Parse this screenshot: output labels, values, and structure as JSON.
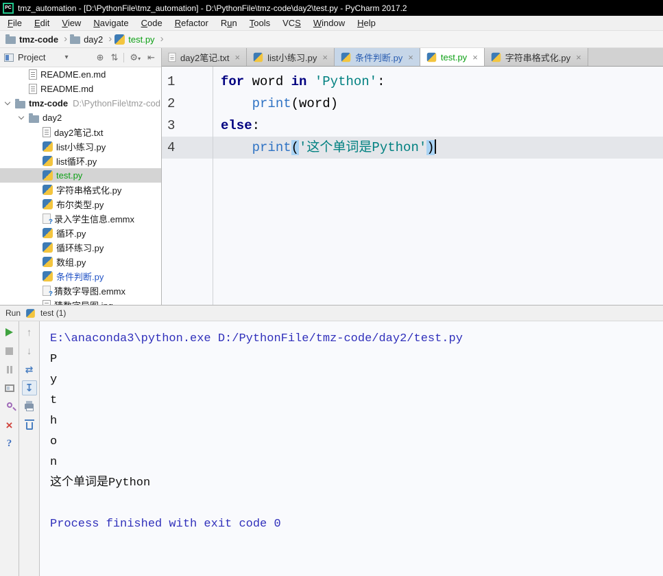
{
  "window": {
    "logo": "PC",
    "title": "tmz_automation - [D:\\PythonFile\\tmz_automation] - D:\\PythonFile\\tmz-code\\day2\\test.py - PyCharm 2017.2"
  },
  "menu": {
    "items": [
      {
        "label": "File",
        "mnemonic": 0
      },
      {
        "label": "Edit",
        "mnemonic": 0
      },
      {
        "label": "View",
        "mnemonic": 0
      },
      {
        "label": "Navigate",
        "mnemonic": 0
      },
      {
        "label": "Code",
        "mnemonic": 0
      },
      {
        "label": "Refactor",
        "mnemonic": 0
      },
      {
        "label": "Run",
        "mnemonic": 1
      },
      {
        "label": "Tools",
        "mnemonic": 0
      },
      {
        "label": "VCS",
        "mnemonic": 2
      },
      {
        "label": "Window",
        "mnemonic": 0
      },
      {
        "label": "Help",
        "mnemonic": 0
      }
    ]
  },
  "breadcrumbs": [
    {
      "label": "tmz-code",
      "icon": "folder",
      "bold": true
    },
    {
      "label": "day2",
      "icon": "folder"
    },
    {
      "label": "test.py",
      "icon": "py",
      "color": "green"
    }
  ],
  "project": {
    "title": "Project",
    "tree": [
      {
        "label": "README.en.md",
        "icon": "txt",
        "indent": 1
      },
      {
        "label": "README.md",
        "icon": "txt",
        "indent": 1
      },
      {
        "label": "tmz-code",
        "icon": "folder",
        "indent": 0,
        "chevron": true,
        "bold": true,
        "path": "D:\\PythonFile\\tmz-cod"
      },
      {
        "label": "day2",
        "icon": "folder",
        "indent": 1,
        "chevron": true
      },
      {
        "label": "day2笔记.txt",
        "icon": "txt",
        "indent": 2
      },
      {
        "label": "list小练习.py",
        "icon": "py",
        "indent": 2
      },
      {
        "label": "list循环.py",
        "icon": "py",
        "indent": 2
      },
      {
        "label": "test.py",
        "icon": "py",
        "indent": 2,
        "selected": true,
        "color": "green"
      },
      {
        "label": "字符串格式化.py",
        "icon": "py",
        "indent": 2
      },
      {
        "label": "布尔类型.py",
        "icon": "py",
        "indent": 2
      },
      {
        "label": "录入学生信息.emmx",
        "icon": "unknown",
        "indent": 2
      },
      {
        "label": "循环.py",
        "icon": "py",
        "indent": 2
      },
      {
        "label": "循环练习.py",
        "icon": "py",
        "indent": 2
      },
      {
        "label": "数组.py",
        "icon": "py",
        "indent": 2
      },
      {
        "label": "条件判断.py",
        "icon": "py",
        "indent": 2,
        "color": "blue"
      },
      {
        "label": "猜数字导图.emmx",
        "icon": "unknown",
        "indent": 2
      },
      {
        "label": "猜数字导图.jpg",
        "icon": "txt",
        "indent": 2
      }
    ]
  },
  "tabs": [
    {
      "label": "day2笔记.txt",
      "icon": "txt",
      "close": "×"
    },
    {
      "label": "list小练习.py",
      "icon": "py",
      "close": "×"
    },
    {
      "label": "条件判断.py",
      "icon": "py",
      "close": "×",
      "state": "modified"
    },
    {
      "label": "test.py",
      "icon": "py",
      "close": "×",
      "state": "active-new"
    },
    {
      "label": "字符串格式化.py",
      "icon": "py",
      "close": "×"
    }
  ],
  "editor": {
    "lines": [
      {
        "num": "1",
        "segments": [
          {
            "t": "for",
            "c": "kw"
          },
          {
            "t": " word ",
            "c": "plain"
          },
          {
            "t": "in",
            "c": "kw"
          },
          {
            "t": " ",
            "c": "plain"
          },
          {
            "t": "'Python'",
            "c": "str"
          },
          {
            "t": ":",
            "c": "plain"
          }
        ]
      },
      {
        "num": "2",
        "segments": [
          {
            "t": "    ",
            "c": "plain"
          },
          {
            "t": "print",
            "c": "builtin"
          },
          {
            "t": "(word)",
            "c": "plain"
          }
        ]
      },
      {
        "num": "3",
        "segments": [
          {
            "t": "else",
            "c": "kw"
          },
          {
            "t": ":",
            "c": "plain"
          }
        ]
      },
      {
        "num": "4",
        "current": true,
        "cursor": true,
        "segments": [
          {
            "t": "    ",
            "c": "plain"
          },
          {
            "t": "print",
            "c": "builtin"
          },
          {
            "t": "(",
            "c": "paren"
          },
          {
            "t": "'这个单词是Python'",
            "c": "str"
          },
          {
            "t": ")",
            "c": "paren"
          }
        ]
      }
    ]
  },
  "run": {
    "label": "Run",
    "tab_label": "test (1)",
    "toolbar_main": [
      "rerun",
      "stop",
      "pause",
      "restore-layout",
      "pin",
      "close",
      "help"
    ],
    "toolbar_console": [
      "up",
      "down",
      "soft-wrap",
      "scroll-end",
      "print",
      "clear"
    ],
    "selected_tool": "scroll-end",
    "output": [
      {
        "text": "E:\\anaconda3\\python.exe D:/PythonFile/tmz-code/day2/test.py",
        "color": "system"
      },
      {
        "text": "P"
      },
      {
        "text": "y"
      },
      {
        "text": "t"
      },
      {
        "text": "h"
      },
      {
        "text": "o"
      },
      {
        "text": "n"
      },
      {
        "text": "这个单词是Python"
      },
      {
        "text": " "
      },
      {
        "text": "Process finished with exit code 0",
        "color": "system"
      }
    ]
  },
  "colors": {
    "keyword": "#000080",
    "builtin": "#2f73c4",
    "string": "#008080",
    "vcs_added_green": "#0da015",
    "vcs_modified_blue": "#2253c5",
    "console_system": "#3030bb",
    "current_line": "#e4e6ea",
    "paren_match": "#a9d3f4"
  },
  "icons": {
    "glyphs": {
      "chevron-down": "▾",
      "locate": "⊕",
      "collapse-all": "⇅",
      "gear": "⚙",
      "hide-panel": "⇤",
      "crumb-separator": "›",
      "close": "×",
      "up": "↑",
      "down": "↓",
      "soft-wrap": "⇄",
      "scroll-end": "↧"
    }
  }
}
